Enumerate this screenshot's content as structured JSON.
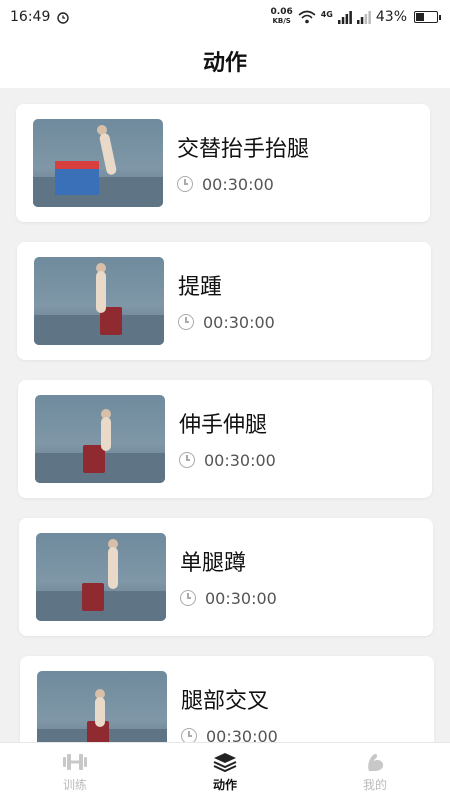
{
  "status_bar": {
    "time": "16:49",
    "net_speed_value": "0.06",
    "net_speed_unit": "KB/S",
    "network": "4G",
    "battery_percent_text": "43%",
    "battery_level": 0.43
  },
  "header": {
    "title": "动作"
  },
  "actions": [
    {
      "name": "交替抬手抬腿",
      "duration": "00:30:00"
    },
    {
      "name": "提踵",
      "duration": "00:30:00"
    },
    {
      "name": "伸手伸腿",
      "duration": "00:30:00"
    },
    {
      "name": "单腿蹲",
      "duration": "00:30:00"
    },
    {
      "name": "腿部交叉",
      "duration": "00:30:00"
    }
  ],
  "tabs": [
    {
      "label": "训练",
      "icon": "dumbbell-icon",
      "active": false
    },
    {
      "label": "动作",
      "icon": "layers-icon",
      "active": true
    },
    {
      "label": "我的",
      "icon": "arm-muscle-icon",
      "active": false
    }
  ],
  "colors": {
    "background": "#f1f1f1",
    "card": "#ffffff",
    "active_tab": "#111111",
    "inactive_tab": "#bbbbbb"
  }
}
